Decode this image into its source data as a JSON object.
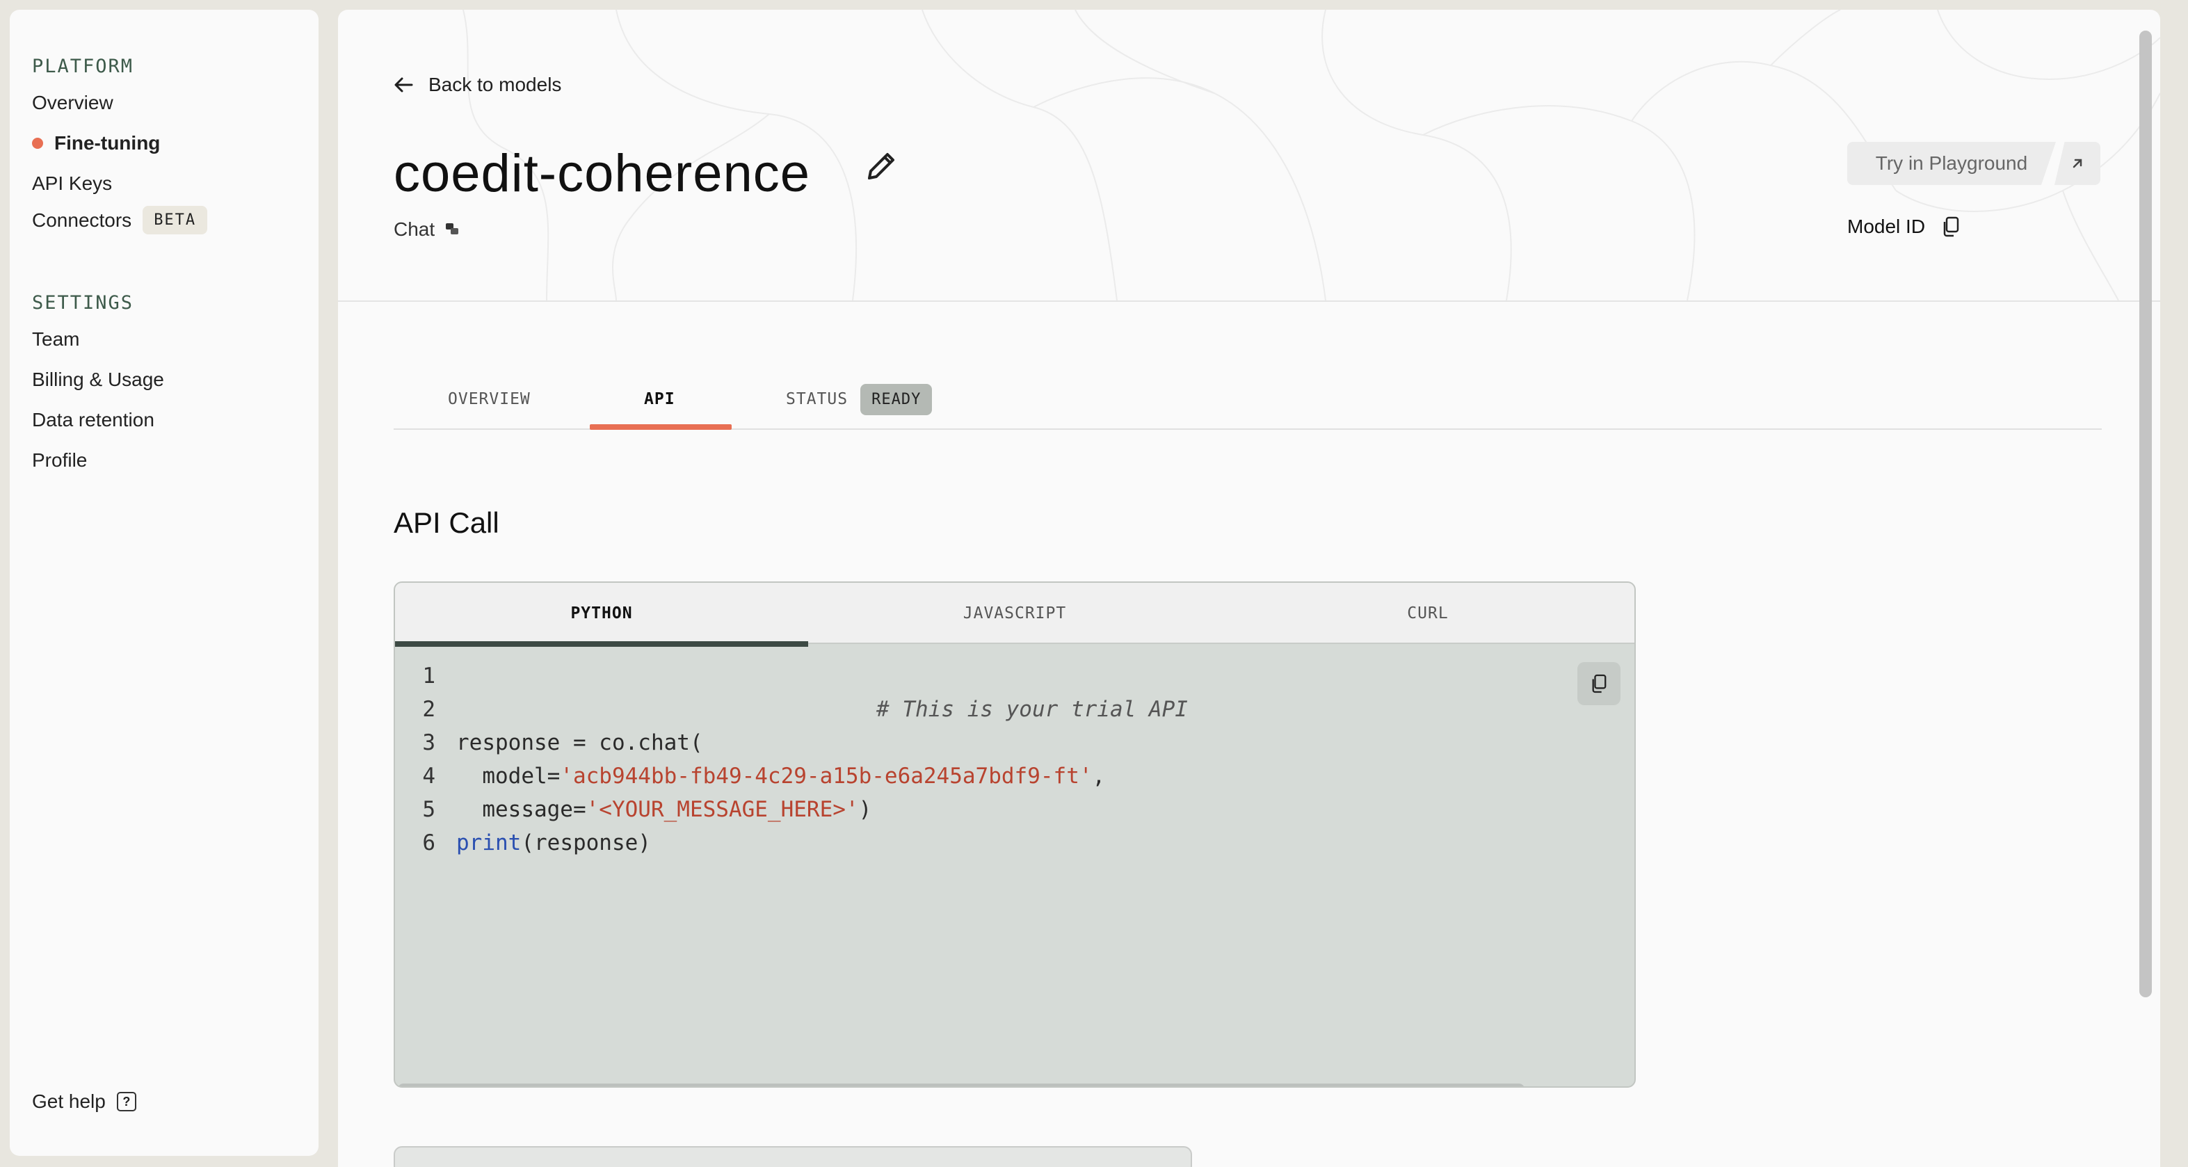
{
  "sidebar": {
    "platform_title": "PLATFORM",
    "platform_items": [
      {
        "label": "Overview"
      },
      {
        "label": "Fine-tuning",
        "active": true
      },
      {
        "label": "API Keys"
      },
      {
        "label": "Connectors",
        "badge": "BETA"
      }
    ],
    "settings_title": "SETTINGS",
    "settings_items": [
      {
        "label": "Team"
      },
      {
        "label": "Billing & Usage"
      },
      {
        "label": "Data retention"
      },
      {
        "label": "Profile"
      }
    ],
    "help_label": "Get help",
    "help_icon": "?"
  },
  "header": {
    "back_label": "Back to models",
    "model_name": "coedit-coherence",
    "model_type": "Chat",
    "try_button": "Try in Playground",
    "model_id_label": "Model ID"
  },
  "tabs": {
    "overview": "OVERVIEW",
    "api": "API",
    "status": "STATUS",
    "status_badge": "READY"
  },
  "api_section": {
    "title": "API Call",
    "code_tabs": [
      "PYTHON",
      "JAVASCRIPT",
      "CURL"
    ],
    "active_code_tab": "PYTHON",
    "code": {
      "line_numbers": [
        "1",
        "2",
        "3",
        "4",
        "5",
        "6"
      ],
      "comment": "# This is your trial API",
      "l3": "response = co.chat(",
      "l4_key": "  model=",
      "l4_val": "'acb944bb-fb49-4c29-a15b-e6a245a7bdf9-ft'",
      "l4_end": ",",
      "l5_key": "  message=",
      "l5_val": "'<YOUR_MESSAGE_HERE>'",
      "l5_end": ")",
      "l6_kw": "print",
      "l6_rest": "(response)"
    }
  },
  "colors": {
    "accent": "#e86f53",
    "code_bg": "#d6dbd7",
    "string": "#b8432f",
    "keyword": "#2a4fb0",
    "section_title": "#3d5a4a"
  }
}
